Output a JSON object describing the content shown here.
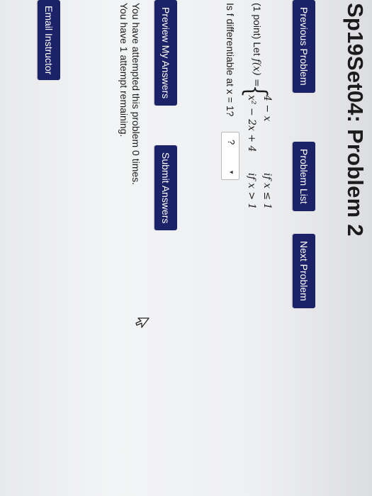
{
  "page": {
    "title": "Sp19Set04: Problem 2"
  },
  "nav": {
    "previous_label": "Previous Problem",
    "list_label": "Problem List",
    "next_label": "Next Problem"
  },
  "problem": {
    "points": "(1 point) Let",
    "f_def": "f(x) =",
    "pieces": [
      {
        "expr": "4 − x",
        "cond": "if x ≤ 1"
      },
      {
        "expr": "x² − 2x + 4",
        "cond": "if x > 1"
      }
    ],
    "question": "Is f differentiable at x = 1?",
    "answer_selected": "?"
  },
  "actions": {
    "preview_label": "Preview My Answers",
    "submit_label": "Submit Answers"
  },
  "status": {
    "attempted": "You have attempted this problem 0 times.",
    "remaining": "You have 1 attempt remaining."
  },
  "footer": {
    "email_label": "Email Instructor"
  },
  "colors": {
    "button_bg": "#1c2268",
    "button_text": "#ffffff"
  },
  "icons": {
    "cursor": "mouse-pointer-icon",
    "select_caret": "caret-down-icon"
  }
}
